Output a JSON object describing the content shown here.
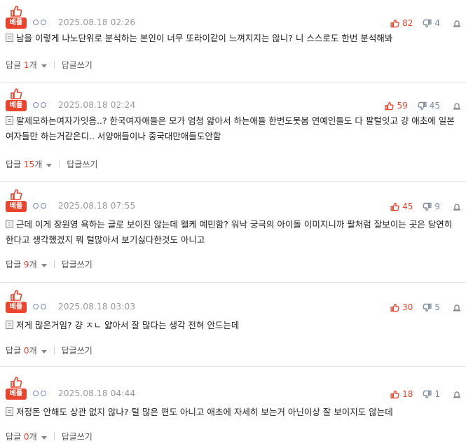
{
  "ui": {
    "badge_label": "베플",
    "reply_label": "답글",
    "reply_unit": "개",
    "write_reply_label": "답글쓰기"
  },
  "comments": [
    {
      "date": "2025.08.18 02:26",
      "up": "82",
      "down": "4",
      "text": "남을 이렇게 나노단위로 분석하는 본인이 너무 또라이같이 느껴지지는 않니? 니 스스로도 한번 분석해봐",
      "replies": "1"
    },
    {
      "date": "2025.08.18 02:24",
      "up": "59",
      "down": "45",
      "text": "팔제모하는여자가잇음..? 한국여자애들은 모가 엄청 얇아서 하는애들 한번도못봄 연예인들도 다 팔털잇고 걍 애초에 일본여자들만 하는거같은디.. 서양애들이나 중국대만애들도안함",
      "replies": "15"
    },
    {
      "date": "2025.08.18 07:55",
      "up": "45",
      "down": "9",
      "text": "근데 이게 장원영 욕하는 글로 보이진 않는데 왤케 예민함? 워낙 궁극의 아이돌 이미지니까 팔처럼 잘보이는 곳은 당연히 한다고 생각했겠지 뭐 털많아서 보기싫다한것도 아니고",
      "replies": "9"
    },
    {
      "date": "2025.08.18 03:03",
      "up": "30",
      "down": "5",
      "text": "저게 많은거임? 걍 ㅈㄴ 얇아서 잘 많다는 생각 전혀 안드는데",
      "replies": "0"
    },
    {
      "date": "2025.08.18 04:44",
      "up": "18",
      "down": "1",
      "text": "저정돈 안해도 상관 없지 않나? 털 많은 편도 아니고 애초에 자세히 보는거 아닌이상 잘 보이지도 않는데",
      "replies": "0"
    }
  ]
}
